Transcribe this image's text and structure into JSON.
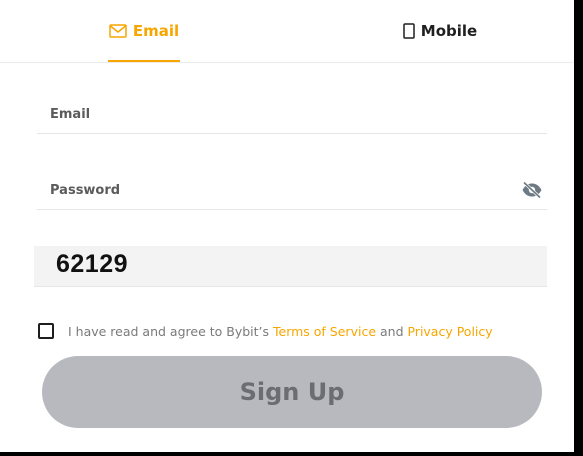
{
  "tabs": {
    "email_label": "Email",
    "mobile_label": "Mobile",
    "email_icon": "envelope-icon",
    "mobile_icon": "phone-icon"
  },
  "form": {
    "email_label": "Email",
    "password_label": "Password",
    "password_toggle_icon": "eye-off-icon",
    "captcha_value": "62129"
  },
  "agreement": {
    "prefix": "I have read and agree to Bybit’s ",
    "terms_link": "Terms of Service",
    "conjunction": " and ",
    "privacy_link": "Privacy Policy",
    "checked": false
  },
  "actions": {
    "signup_label": "Sign Up"
  },
  "colors": {
    "accent": "#f7a600",
    "button_disabled_bg": "#b8b8bf",
    "button_disabled_text": "#6c6c73"
  }
}
